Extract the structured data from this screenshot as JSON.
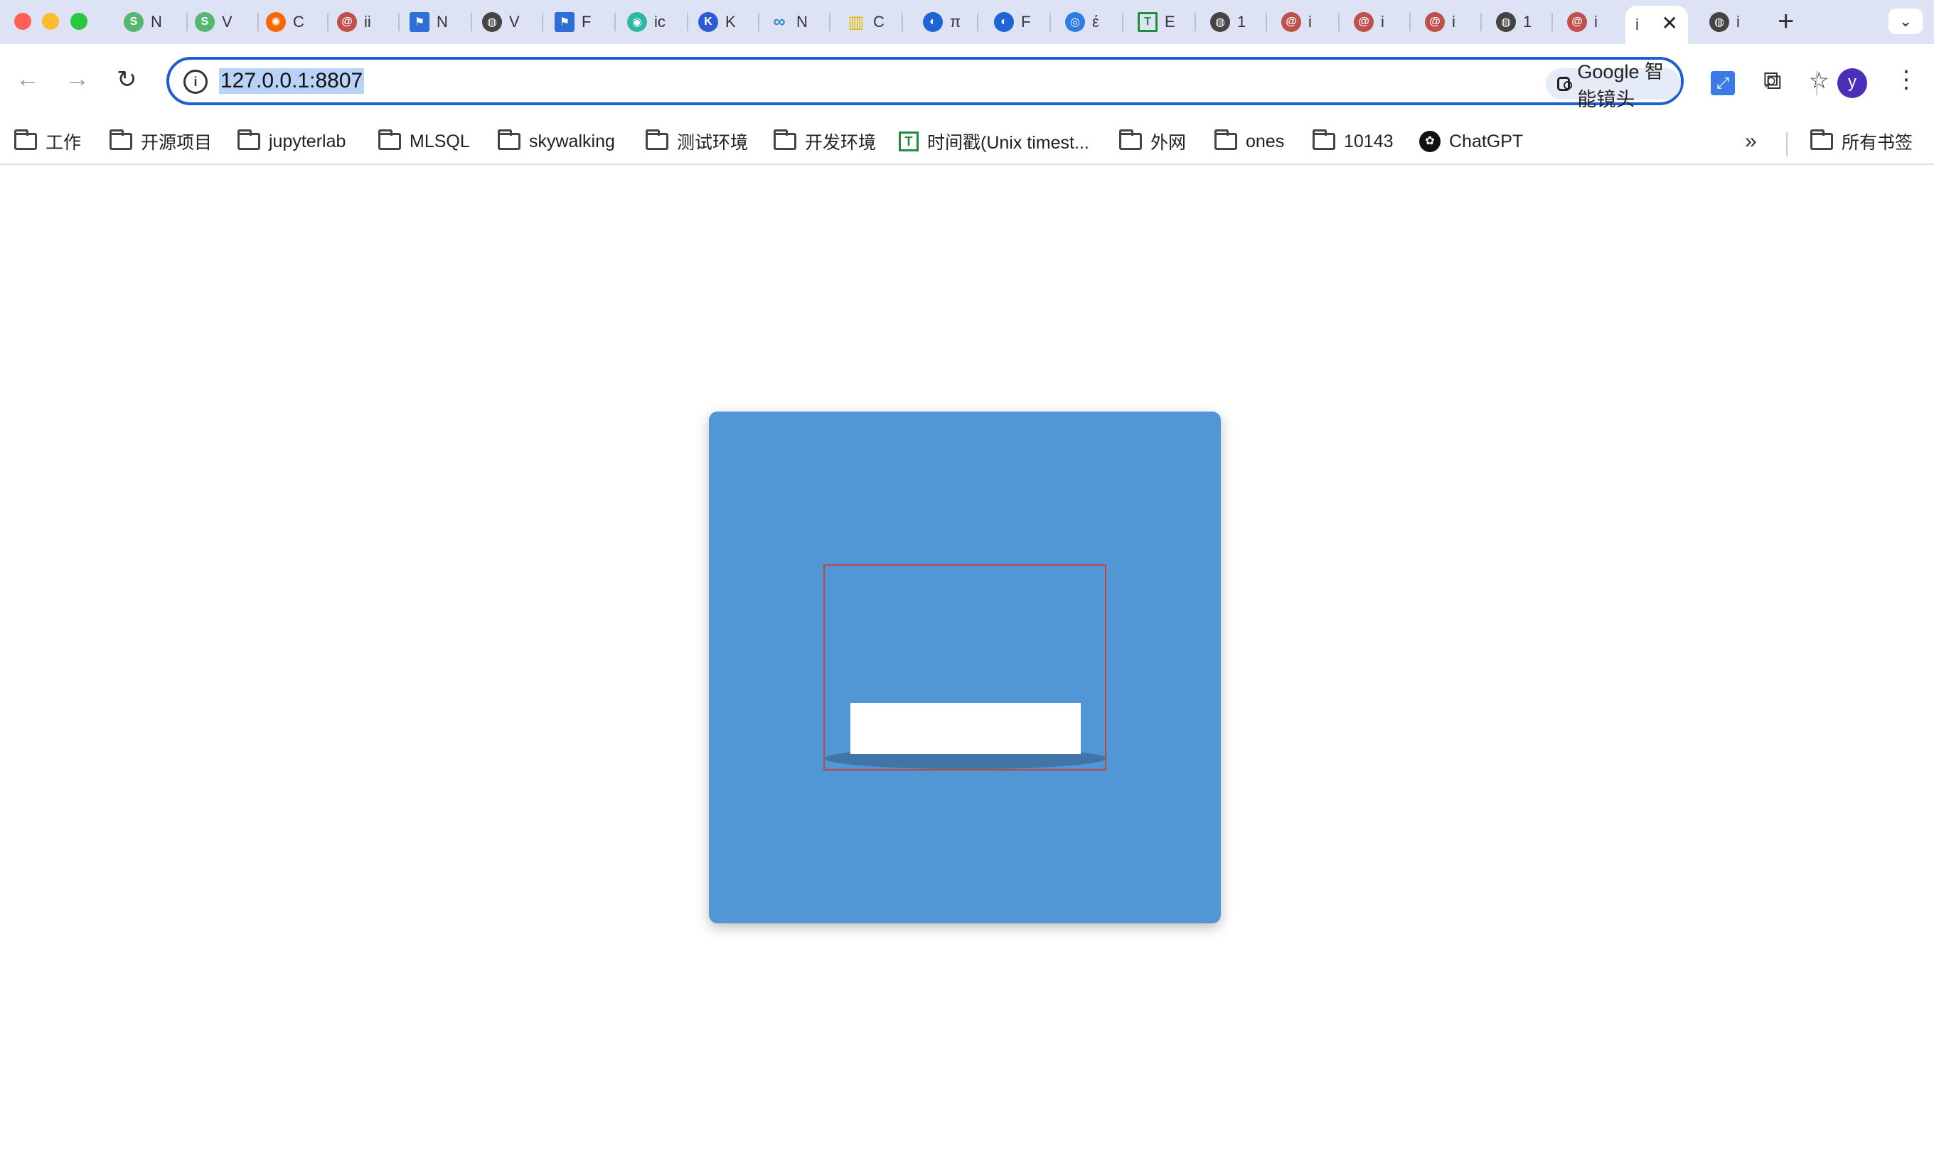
{
  "browser": {
    "tabs": [
      {
        "label": "N",
        "icon": "green-s-icon",
        "color": "#56b870"
      },
      {
        "label": "V",
        "icon": "green-s-icon",
        "color": "#56b870"
      },
      {
        "label": "C",
        "icon": "grafana-icon",
        "color": "#f46800"
      },
      {
        "label": "ii",
        "icon": "snail-icon",
        "color": "#c0504d"
      },
      {
        "label": "N",
        "icon": "flag-icon",
        "color": "#2d6fd6"
      },
      {
        "label": "V",
        "icon": "globe-icon",
        "color": "#444444"
      },
      {
        "label": "F",
        "icon": "flag-icon",
        "color": "#2d6fd6"
      },
      {
        "label": "ic",
        "icon": "alien-icon",
        "color": "#2fb7a6"
      },
      {
        "label": "K",
        "icon": "k-icon",
        "color": "#2d5bd6"
      },
      {
        "label": "N",
        "icon": "infinity-icon",
        "color": "#2d8bd6"
      },
      {
        "label": "C",
        "icon": "bars-icon",
        "color": "#e0b500"
      },
      {
        "label": "π",
        "icon": "drop-icon",
        "color": "#1f63d6"
      },
      {
        "label": "F",
        "icon": "drop-icon",
        "color": "#1f63d6"
      },
      {
        "label": "έ",
        "icon": "compass-icon",
        "color": "#2f7de0"
      },
      {
        "label": "E",
        "icon": "sheet-icon",
        "color": "#1e8e3e"
      },
      {
        "label": "1",
        "icon": "globe-icon",
        "color": "#444444"
      },
      {
        "label": "i",
        "icon": "snail-icon",
        "color": "#c0504d"
      },
      {
        "label": "i",
        "icon": "snail-icon",
        "color": "#c0504d"
      },
      {
        "label": "i",
        "icon": "snail-icon",
        "color": "#c0504d"
      },
      {
        "label": "1",
        "icon": "globe-icon",
        "color": "#444444"
      },
      {
        "label": "i",
        "icon": "snail-icon",
        "color": "#c0504d"
      }
    ],
    "active_tab": {
      "label": "i",
      "close": "✕"
    },
    "after_tab": {
      "label": "i",
      "icon": "globe-icon"
    },
    "new_tab": "+",
    "tab_menu": "⌄",
    "nav": {
      "back": "←",
      "forward": "→",
      "reload": "↻"
    },
    "address": {
      "url": "127.0.0.1:8807",
      "info": "i"
    },
    "lens_label": "Google 智能镜头",
    "zoom_icon": "⌕",
    "star_icon": "☆",
    "avatar_letter": "y",
    "menu_icon": "⋮",
    "ext_icon": "⤢",
    "puzzle_icon": "⧉"
  },
  "bookmarks": {
    "items": [
      {
        "label": "工作",
        "icon": "folder-icon"
      },
      {
        "label": "开源项目",
        "icon": "folder-icon"
      },
      {
        "label": "jupyterlab",
        "icon": "folder-icon"
      },
      {
        "label": "MLSQL",
        "icon": "folder-icon"
      },
      {
        "label": "skywalking",
        "icon": "folder-icon"
      },
      {
        "label": "测试环境",
        "icon": "folder-icon"
      },
      {
        "label": "开发环境",
        "icon": "folder-icon"
      },
      {
        "label": "时间戳(Unix timest...",
        "icon": "sheet-icon"
      },
      {
        "label": "外网",
        "icon": "folder-icon"
      },
      {
        "label": "ones",
        "icon": "folder-icon"
      },
      {
        "label": "10143",
        "icon": "folder-icon"
      },
      {
        "label": "ChatGPT",
        "icon": "openai-icon"
      }
    ],
    "more": "»",
    "all_bookmarks": "所有书签"
  },
  "scene": {
    "background_color": "#5197d5",
    "block_color": "#ffffff",
    "shadow_color": "#3f75a8",
    "frame_color": "#c2463e"
  }
}
